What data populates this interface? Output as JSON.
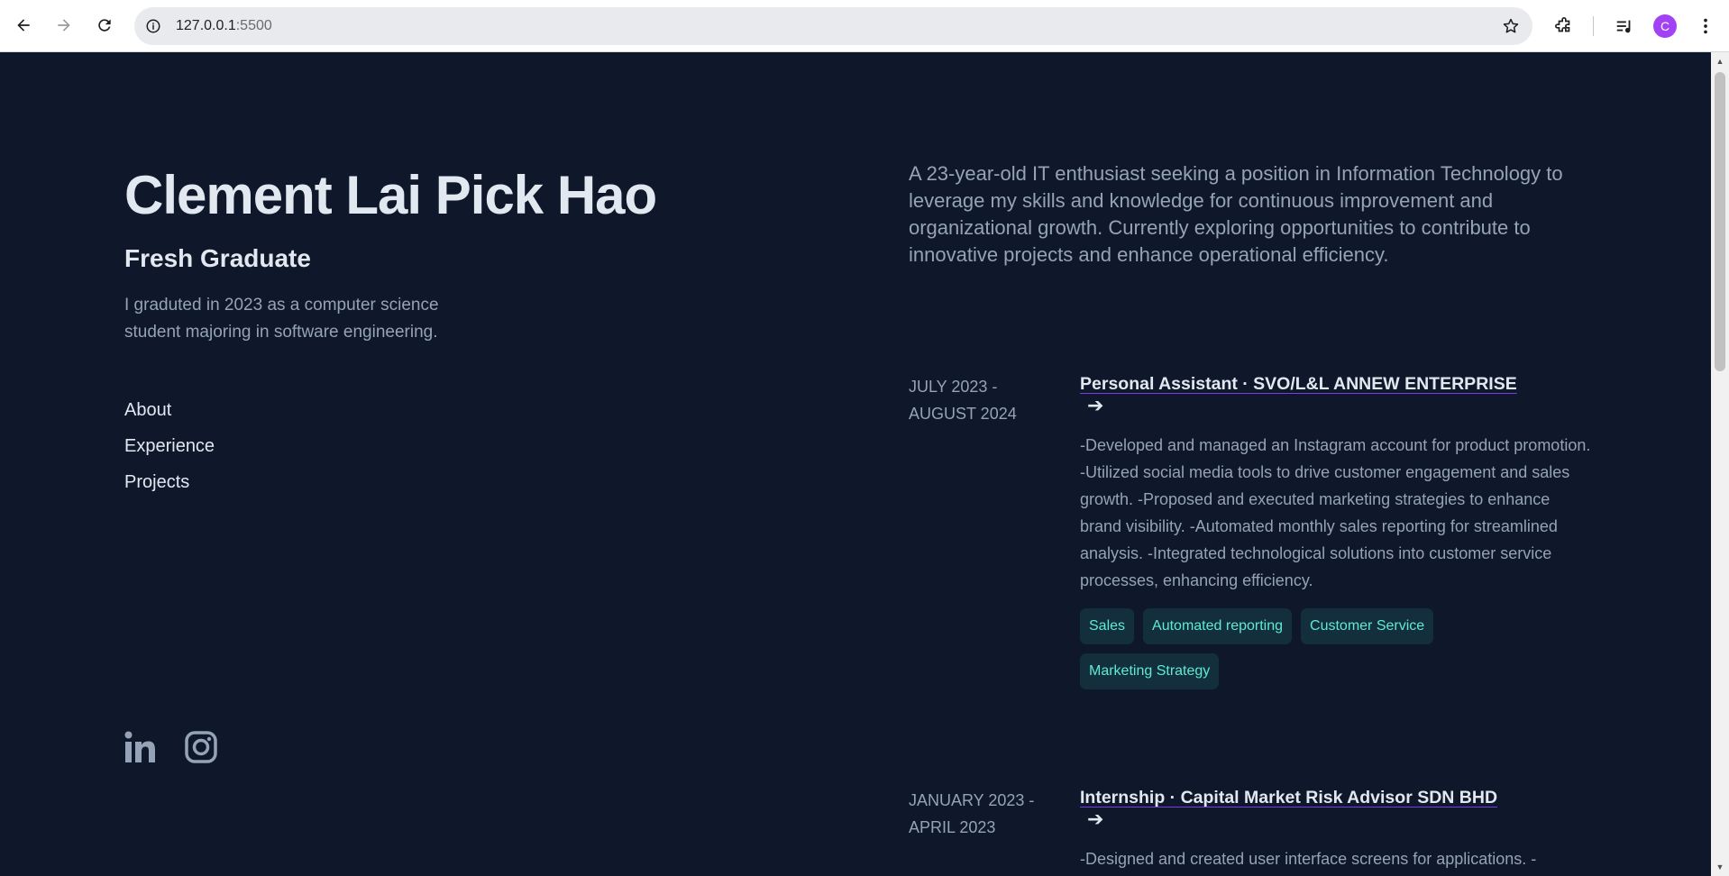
{
  "browser": {
    "url_host": "127.0.0.1",
    "url_port": ":5500",
    "profile_initial": "C"
  },
  "profile": {
    "name": "Clement Lai Pick Hao",
    "role": "Fresh Graduate",
    "intro": "I graduted in 2023 as a computer science student majoring in software engineering."
  },
  "nav": {
    "items": [
      "About",
      "Experience",
      "Projects"
    ]
  },
  "social": [
    "linkedin-icon",
    "instagram-icon"
  ],
  "about": "A 23-year-old IT enthusiast seeking a position in Information Technology to leverage my skills and knowledge for continuous improvement and organizational growth. Currently exploring opportunities to contribute to innovative projects and enhance operational efficiency.",
  "experience": [
    {
      "date": "July 2023 - August 2024",
      "title": "Personal Assistant · SVO/L&L ANNEW ENTERPRISE",
      "description": "-Developed and managed an Instagram account for product promotion. -Utilized social media tools to drive customer engagement and sales growth. -Proposed and executed marketing strategies to enhance brand visibility. -Automated monthly sales reporting for streamlined analysis. -Integrated technological solutions into customer service processes, enhancing efficiency.",
      "tags": [
        "Sales",
        "Automated reporting",
        "Customer Service",
        "Marketing Strategy"
      ]
    },
    {
      "date": "January 2023 - April 2023",
      "title": "Internship · Capital Market Risk Advisor SDN BHD",
      "description": "-Designed and created user interface screens for applications. -"
    }
  ],
  "colors": {
    "background": "#0f172a",
    "heading": "#e2e8f0",
    "body_text": "#94a3b8",
    "tag_text": "#5eead4",
    "tag_bg": "#132f3e",
    "avatar": "#a142f4"
  }
}
